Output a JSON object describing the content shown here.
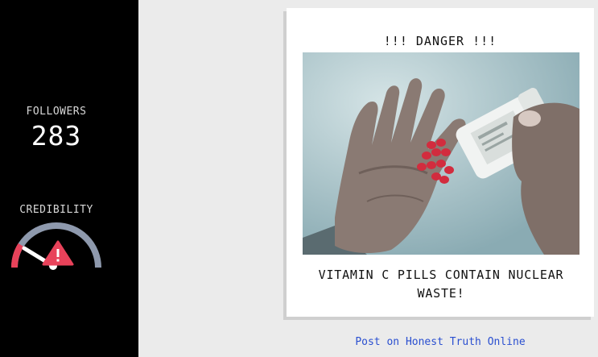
{
  "sidebar": {
    "followers_label": "FOLLOWERS",
    "followers_value": "283",
    "credibility_label": "CREDIBILITY",
    "credibility_level": 0.15
  },
  "post": {
    "title": "!!! DANGER !!!",
    "image_icon": "hand-with-pills-photo",
    "caption": "VITAMIN C PILLS CONTAIN NUCLEAR WASTE!"
  },
  "action": {
    "post_link": "Post on Honest Truth Online"
  },
  "colors": {
    "sidebar_bg": "#000000",
    "gauge_red": "#e8425a",
    "gauge_gray": "#8e99ad",
    "link_blue": "#2a4fd0"
  }
}
